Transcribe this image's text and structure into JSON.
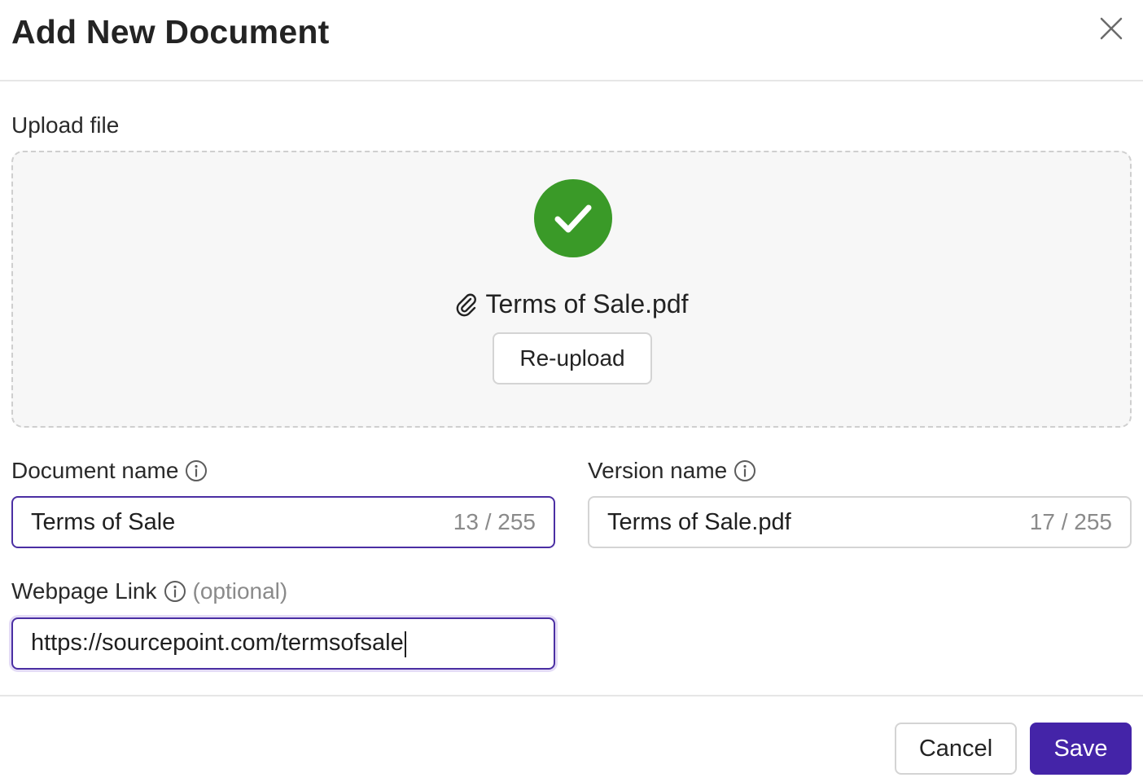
{
  "dialog": {
    "title": "Add New Document"
  },
  "upload": {
    "label": "Upload file",
    "status": "success",
    "file_name": "Terms of Sale.pdf",
    "reupload_label": "Re-upload"
  },
  "fields": {
    "document_name": {
      "label": "Document name",
      "value": "Terms of Sale",
      "counter": "13 / 255"
    },
    "version_name": {
      "label": "Version name",
      "value": "Terms of Sale.pdf",
      "counter": "17 / 255"
    },
    "webpage_link": {
      "label": "Webpage Link",
      "optional_label": "(optional)",
      "value": "https://sourcepoint.com/termsofsale"
    }
  },
  "footer": {
    "cancel_label": "Cancel",
    "save_label": "Save"
  },
  "colors": {
    "primary": "#4424a8",
    "success": "#3a9a28",
    "focus_border": "#4b2fa3",
    "muted_text": "#8a8a8a"
  },
  "icons": {
    "close": "close-icon",
    "success": "check-circle-icon",
    "attachment": "paperclip-icon",
    "info": "info-icon"
  }
}
